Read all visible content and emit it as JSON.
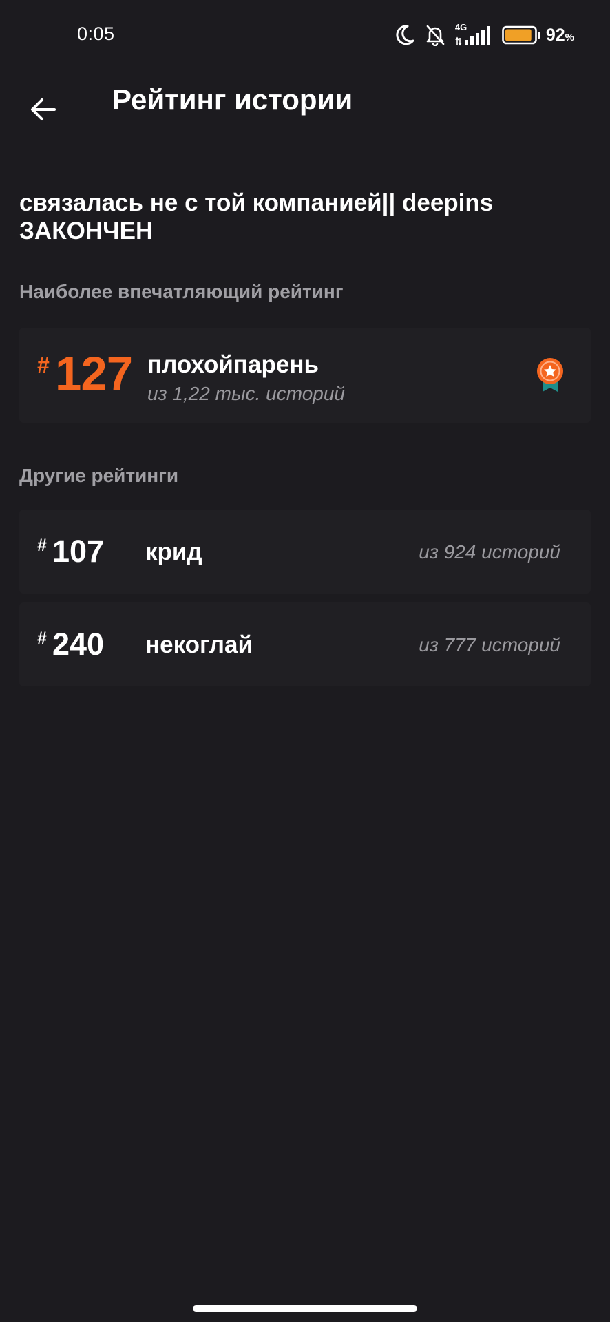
{
  "status_bar": {
    "time": "0:05",
    "network": "4G",
    "battery_percent": "92",
    "battery_unit": "%",
    "battery_level": 0.92,
    "battery_color": "#f0a026",
    "icons": [
      "moon-icon",
      "bell-off-icon",
      "signal-icon",
      "battery-icon"
    ]
  },
  "app_bar": {
    "title": "Рейтинг истории",
    "back_icon": "arrow-left-icon"
  },
  "story": {
    "title_line1": "связалась не с той компанией|| deepins",
    "title_line2": "ЗАКОНЧЕН"
  },
  "best_ranking": {
    "section_label": "Наиболее впечатляющий рейтинг",
    "hash": "#",
    "rank": "127",
    "tag": "плохойпарень",
    "subtitle": "из 1,22 тыс. историй",
    "accent_color": "#f4651f",
    "badge_icon": "medal-icon"
  },
  "other_rankings": {
    "section_label": "Другие рейтинги",
    "items": [
      {
        "hash": "#",
        "rank": "107",
        "tag": "крид",
        "subtitle": "из 924 историй"
      },
      {
        "hash": "#",
        "rank": "240",
        "tag": "некоглай",
        "subtitle": "из 777 историй"
      }
    ]
  }
}
